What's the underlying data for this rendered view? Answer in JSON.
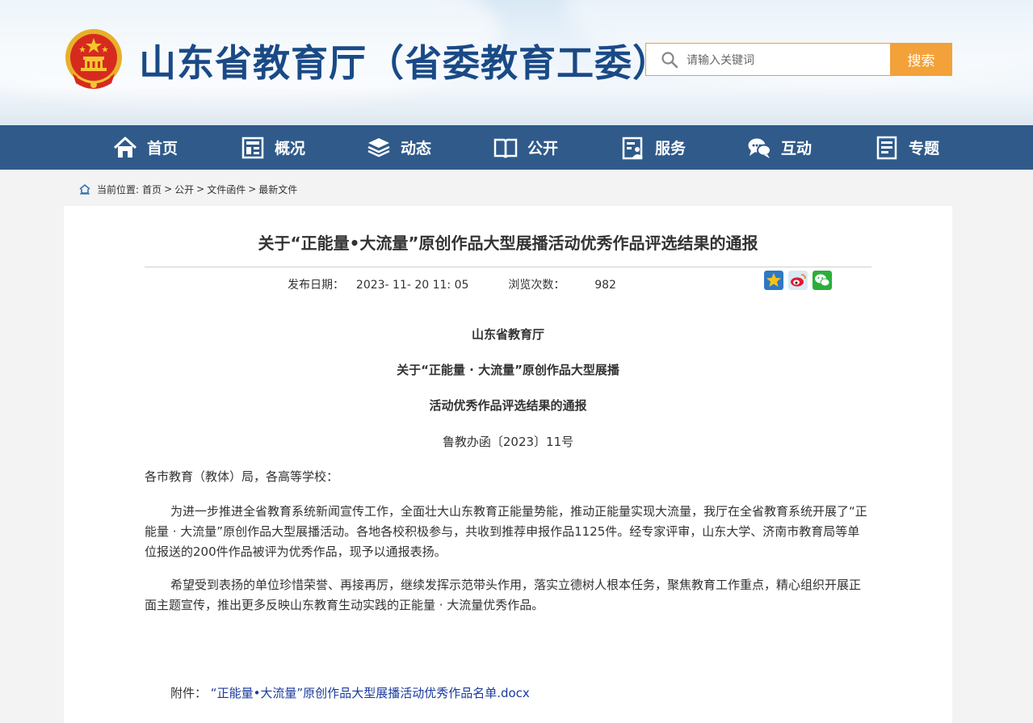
{
  "header": {
    "site_title": "山东省教育厅（省委教育工委）",
    "search_placeholder": "请输入关键词",
    "search_button": "搜索"
  },
  "nav": [
    {
      "label": "首页",
      "icon": "home-icon"
    },
    {
      "label": "概况",
      "icon": "overview-icon"
    },
    {
      "label": "动态",
      "icon": "news-stack-icon"
    },
    {
      "label": "公开",
      "icon": "open-book-icon"
    },
    {
      "label": "服务",
      "icon": "service-icon"
    },
    {
      "label": "互动",
      "icon": "chat-icon"
    },
    {
      "label": "专题",
      "icon": "document-icon"
    }
  ],
  "breadcrumb": {
    "prefix": "当前位置:",
    "items": [
      "首页",
      "公开",
      "文件函件",
      "最新文件"
    ],
    "separator": ">"
  },
  "article": {
    "title": "关于“正能量•大流量”原创作品大型展播活动优秀作品评选结果的通报",
    "publish_label": "发布日期：",
    "publish_date": "2023- 11- 20 11: 05",
    "views_label": "浏览次数：",
    "views": "982",
    "share_icons": [
      "favorite-star-icon",
      "weibo-icon",
      "wechat-icon"
    ],
    "issuer": "山东省教育厅",
    "heading_line1": "关于“正能量 · 大流量”原创作品大型展播",
    "heading_line2": "活动优秀作品评选结果的通报",
    "doc_number": "鲁教办函〔2023〕11号",
    "salutation": "各市教育（教体）局，各高等学校：",
    "paragraph1": "为进一步推进全省教育系统新闻宣传工作，全面壮大山东教育正能量势能，推动正能量实现大流量，我厅在全省教育系统开展了“正能量 · 大流量”原创作品大型展播活动。各地各校积极参与，共收到推荐申报作品1125件。经专家评审，山东大学、济南市教育局等单位报送的200件作品被评为优秀作品，现予以通报表扬。",
    "paragraph2": "希望受到表扬的单位珍惜荣誉、再接再厉，继续发挥示范带头作用，落实立德树人根本任务，聚焦教育工作重点，精心组织开展正面主题宣传，推出更多反映山东教育生动实践的正能量 · 大流量优秀作品。",
    "attachment_label": "附件：",
    "attachment_link": "“正能量•大流量”原创作品大型展播活动优秀作品名单.docx"
  },
  "colors": {
    "nav_bg": "#2f5a8a",
    "title_blue": "#1a4a86",
    "search_orange": "#f3a23a",
    "link_blue": "#1a3a9e"
  }
}
